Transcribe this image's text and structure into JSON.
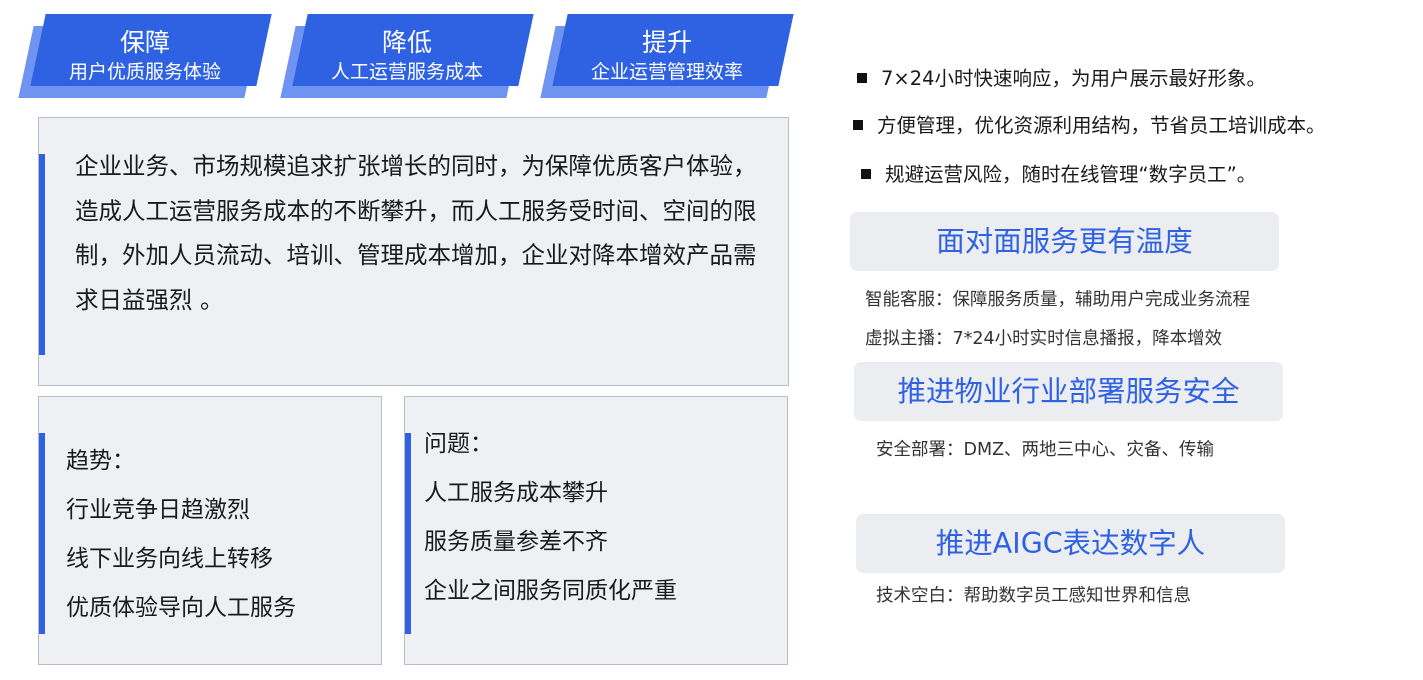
{
  "banners": [
    {
      "title": "保障",
      "subtitle": "用户优质服务体验"
    },
    {
      "title": "降低",
      "subtitle": "人工运营服务成本"
    },
    {
      "title": "提升",
      "subtitle": "企业运营管理效率"
    }
  ],
  "intro": "企业业务、市场规模追求扩张增长的同时，为保障优质客户体验，造成人工运营服务成本的不断攀升，而人工服务受时间、空间的限制，外加人员流动、培训、管理成本增加，企业对降本增效产品需求日益强烈 。",
  "trends": {
    "heading": "趋势：",
    "items": [
      "行业竞争日趋激烈",
      "线下业务向线上转移",
      "优质体验导向人工服务"
    ]
  },
  "issues": {
    "heading": "问题：",
    "items": [
      "人工服务成本攀升",
      "服务质量参差不齐",
      "企业之间服务同质化严重"
    ]
  },
  "bullets": [
    "7×24小时快速响应，为用户展示最好形象。",
    "方便管理，优化资源利用结构，节省员工培训成本。",
    "规避运营风险，随时在线管理“数字员工”。"
  ],
  "features": [
    {
      "title": "面对面服务更有温度",
      "details": [
        "智能客服：保障服务质量，辅助用户完成业务流程",
        "虚拟主播：7*24小时实时信息播报，降本增效"
      ]
    },
    {
      "title": "推进物业行业部署服务安全",
      "details": [
        "安全部署：DMZ、两地三中心、灾备、传输"
      ]
    },
    {
      "title": "推进AIGC表达数字人",
      "details": [
        "技术空白：帮助数字员工感知世界和信息"
      ]
    }
  ],
  "colors": {
    "accent": "#2f62e3",
    "accent_light": "#6e93f0",
    "panel": "#eef0f3"
  }
}
